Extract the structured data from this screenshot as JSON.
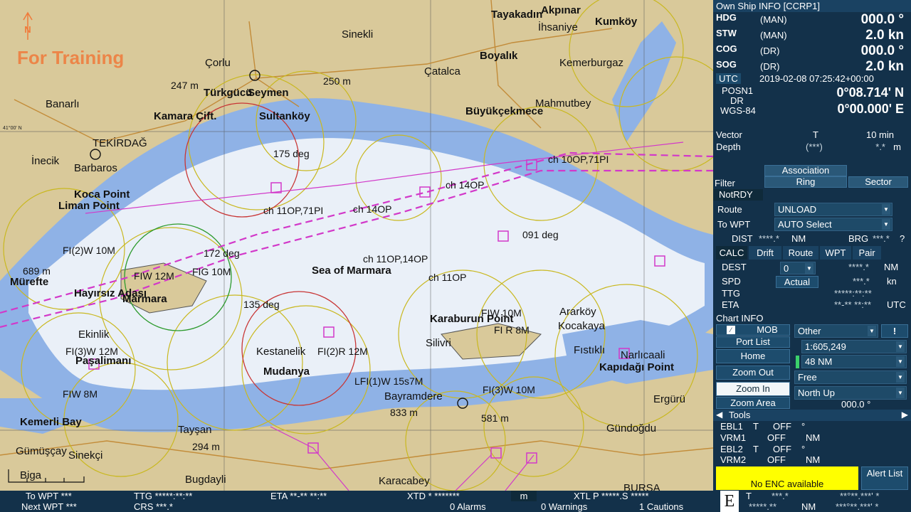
{
  "chart": {
    "training_text": "For Training",
    "north_mark": "N",
    "lat_tick": "41°00' N",
    "places": [
      {
        "t": "Tayakadın",
        "b": true
      },
      {
        "t": "Akpınar",
        "b": true
      },
      {
        "t": "İhsaniye",
        "b": false
      },
      {
        "t": "Kumköy",
        "b": true
      },
      {
        "t": "Sinekli",
        "b": false
      },
      {
        "t": "Boyalık",
        "b": true
      },
      {
        "t": "Kemerburgaz",
        "b": false
      },
      {
        "t": "Çorlu",
        "b": false
      },
      {
        "t": "Çatalca",
        "b": false
      },
      {
        "t": "Banarlı",
        "b": false
      },
      {
        "t": "Türkgücü",
        "b": true
      },
      {
        "t": "Seymen",
        "b": true
      },
      {
        "t": "Mahmutbey",
        "b": false
      },
      {
        "t": "Kamara Çift.",
        "b": true
      },
      {
        "t": "Sultanköy",
        "b": true
      },
      {
        "t": "Büyükçekmece",
        "b": true
      },
      {
        "t": "TEKİRDAĞ",
        "b": false
      },
      {
        "t": "İnecik",
        "b": false
      },
      {
        "t": "Barbaros",
        "b": false
      },
      {
        "t": "Koca Point",
        "b": true
      },
      {
        "t": "Liman Point",
        "b": true
      },
      {
        "t": "Mürefte",
        "b": true
      },
      {
        "t": "Hayırsız Adası",
        "b": true
      },
      {
        "t": "Marmara",
        "b": true
      },
      {
        "t": "Ekinlik",
        "b": false
      },
      {
        "t": "Paşalimanı",
        "b": true
      },
      {
        "t": "Kestanelik",
        "b": false
      },
      {
        "t": "Sea of Marmara",
        "b": true
      },
      {
        "t": "Karaburun Point",
        "b": true
      },
      {
        "t": "Kocakaya",
        "b": false
      },
      {
        "t": "Silivri",
        "b": false
      },
      {
        "t": "Fıstıklı",
        "b": false
      },
      {
        "t": "Ararköy",
        "b": false
      },
      {
        "t": "Narlıcaali",
        "b": false
      },
      {
        "t": "Ergürü",
        "b": false
      },
      {
        "t": "Bayramdere",
        "b": false
      },
      {
        "t": "Gündoğdu",
        "b": false
      },
      {
        "t": "Gümüşçay",
        "b": false
      },
      {
        "t": "Sinekçi",
        "b": false
      },
      {
        "t": "Biga",
        "b": false
      },
      {
        "t": "Bugdayli",
        "b": false
      },
      {
        "t": "Karacabey",
        "b": false
      },
      {
        "t": "BURSA",
        "b": false
      },
      {
        "t": "Tayşan",
        "b": false
      },
      {
        "t": "Kemerli Bay",
        "b": true
      },
      {
        "t": "Kapıdağı Point",
        "b": true
      },
      {
        "t": "Mudanya",
        "b": true
      }
    ],
    "soundings": [
      "247 m",
      "250 m",
      "689 m",
      "833 m",
      "294 m",
      "581 m",
      "175 deg",
      "172 deg",
      "135 deg",
      "091 deg"
    ],
    "light_labels": [
      "ch 11OP,71PI",
      "ch 14OP",
      "ch 11OP,14OP",
      "ch 11OP",
      "ch 14OP",
      "FI(2)W 10M",
      "FI(3)W 12M",
      "FIW 12M",
      "FIG 10M",
      "FIW 10M",
      "FIW 8M",
      "FI(3)W 10M",
      "FI(2)R 12M",
      "LFI(1)W 15s7M",
      "FI R 8M",
      "ch 10OP,71PI"
    ]
  },
  "own_ship": {
    "title": "Own Ship INFO [CCRP1]",
    "rows": [
      {
        "key": "HDG",
        "mode": "(MAN)",
        "value": "000.0 °"
      },
      {
        "key": "STW",
        "mode": "(MAN)",
        "value": "2.0 kn"
      },
      {
        "key": "COG",
        "mode": "(DR)",
        "value": "000.0 °"
      },
      {
        "key": "SOG",
        "mode": "(DR)",
        "value": "2.0 kn"
      }
    ],
    "utc_label": "UTC",
    "utc_value": "2019-02-08 07:25:42+00:00",
    "posn_label": "POSN1",
    "posn_mode": "DR",
    "datum": "WGS-84",
    "lat": "0°08.714' N",
    "lon": "0°00.000' E"
  },
  "vector": {
    "label": "Vector",
    "mode": "T",
    "value": "10 min"
  },
  "depth": {
    "label": "Depth",
    "mode": "(***)",
    "value": "*.*",
    "unit": "m"
  },
  "filter": {
    "association": "Association",
    "label": "Filter",
    "ring": "Ring",
    "sector": "Sector",
    "notrdy": "NotRDY"
  },
  "route": {
    "route_label": "Route",
    "route_value": "UNLOAD",
    "towpt_label": "To WPT",
    "towpt_value": "AUTO Select",
    "dist_label": "DIST",
    "dist_value": "****.*",
    "dist_unit": "NM",
    "brg_label": "BRG",
    "brg_value": "***.*",
    "brg_unit": "?"
  },
  "calc": {
    "tabs": [
      "CALC",
      "Drift",
      "Route",
      "WPT",
      "Pair"
    ],
    "dest_label": "DEST",
    "dest_value": "0",
    "dest_stars": "****.*",
    "dest_unit": "NM",
    "spd_label": "SPD",
    "spd_mode": "Actual",
    "spd_value": "***.*",
    "spd_unit": "kn",
    "ttg_label": "TTG",
    "ttg_value": "*****:**:**",
    "eta_label": "ETA",
    "eta_value": "**-** **:**",
    "eta_unit": "UTC"
  },
  "chart_info": {
    "title": "Chart INFO",
    "mob": "MOB",
    "other": "Other",
    "alert_mark": "!",
    "port_list": "Port List",
    "scale": "1:605,249",
    "home": "Home",
    "range": "48 NM",
    "zoom_out": "Zoom Out",
    "mode": "Free",
    "zoom_in": "Zoom In",
    "orientation": "North Up",
    "zoom_area": "Zoom Area",
    "rotation": "000.0 °"
  },
  "tools": {
    "title": "Tools",
    "ebl1": {
      "label": "EBL1",
      "mode": "T",
      "state": "OFF",
      "unit": "°"
    },
    "vrm1": {
      "label": "VRM1",
      "state": "OFF",
      "unit": "NM"
    },
    "ebl2": {
      "label": "EBL2",
      "mode": "T",
      "state": "OFF",
      "unit": "°"
    },
    "vrm2": {
      "label": "VRM2",
      "state": "OFF",
      "unit": "NM"
    }
  },
  "alert": {
    "enc_message": "No ENC available",
    "alert_list": "Alert List",
    "status_e": "E",
    "cursor_t": "T",
    "cursor_brg": "***.*",
    "cursor_rng": "*****.**",
    "cursor_unit": "NM",
    "cursor_lat": "**°**.***' *",
    "cursor_lon": "***°**.***' *"
  },
  "bottom": {
    "to_wpt": "To WPT ***",
    "next_wpt": "Next WPT ***",
    "ttg": "TTG *****:**:**",
    "crs": "CRS ***.*",
    "eta": "ETA **-** **:**",
    "xtd": "XTD * *******",
    "xtd_unit": "m",
    "xtl": "XTL P *****.S *****",
    "alarms": "0 Alarms",
    "warnings": "0 Warnings",
    "cautions": "1 Cautions"
  },
  "colors": {
    "panel": "#13314a",
    "land": "#d9c99a",
    "shallow": "#8fb2e6",
    "deep": "#eaf0f8",
    "route": "#d238c9",
    "alert": "#ffff00"
  }
}
